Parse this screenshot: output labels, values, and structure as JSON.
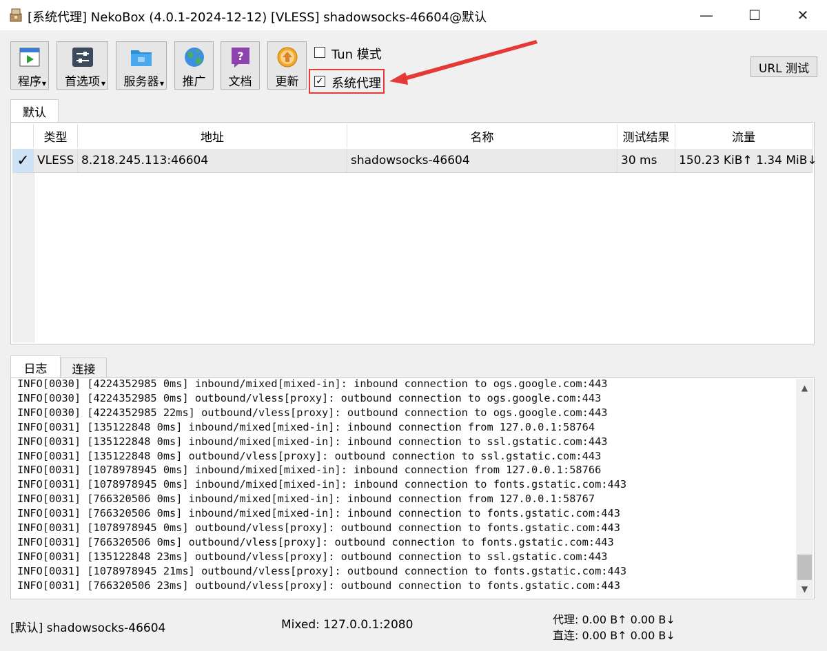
{
  "window": {
    "title": "[系统代理] NekoBox (4.0.1-2024-12-12) [VLESS] shadowsocks-46604@默认",
    "minimize_glyph": "—",
    "maximize_glyph": "☐",
    "close_glyph": "✕"
  },
  "toolbar": {
    "buttons": [
      {
        "label": "程序",
        "icon": "program-icon"
      },
      {
        "label": "首选项",
        "icon": "preferences-icon"
      },
      {
        "label": "服务器",
        "icon": "server-folder-icon"
      },
      {
        "label": "推广",
        "icon": "globe-icon"
      },
      {
        "label": "文档",
        "icon": "help-doc-icon"
      },
      {
        "label": "更新",
        "icon": "update-icon"
      }
    ],
    "tun_mode_label": "Tun 模式",
    "tun_checked": false,
    "system_proxy_label": "系统代理",
    "system_proxy_checked": true,
    "url_test_label": "URL 测试"
  },
  "group_tab": "默认",
  "table": {
    "headers": [
      "类型",
      "地址",
      "名称",
      "测试结果",
      "流量"
    ],
    "rows": [
      {
        "selected_mark": "✓",
        "type": "VLESS",
        "address": "8.218.245.113:46604",
        "name": "shadowsocks-46604",
        "test_result": "30 ms",
        "traffic": "150.23 KiB↑ 1.34 MiB↓"
      }
    ]
  },
  "log_tabs": [
    "日志",
    "连接"
  ],
  "log_lines": [
    "INFO[0030] [4224352985 0ms] inbound/mixed[mixed-in]: inbound connection to ogs.google.com:443",
    "INFO[0030] [4224352985 0ms] outbound/vless[proxy]: outbound connection to ogs.google.com:443",
    "INFO[0030] [4224352985 22ms] outbound/vless[proxy]: outbound connection to ogs.google.com:443",
    "INFO[0031] [135122848 0ms] inbound/mixed[mixed-in]: inbound connection from 127.0.0.1:58764",
    "INFO[0031] [135122848 0ms] inbound/mixed[mixed-in]: inbound connection to ssl.gstatic.com:443",
    "INFO[0031] [135122848 0ms] outbound/vless[proxy]: outbound connection to ssl.gstatic.com:443",
    "INFO[0031] [1078978945 0ms] inbound/mixed[mixed-in]: inbound connection from 127.0.0.1:58766",
    "INFO[0031] [1078978945 0ms] inbound/mixed[mixed-in]: inbound connection to fonts.gstatic.com:443",
    "INFO[0031] [766320506 0ms] inbound/mixed[mixed-in]: inbound connection from 127.0.0.1:58767",
    "INFO[0031] [766320506 0ms] inbound/mixed[mixed-in]: inbound connection to fonts.gstatic.com:443",
    "INFO[0031] [1078978945 0ms] outbound/vless[proxy]: outbound connection to fonts.gstatic.com:443",
    "INFO[0031] [766320506 0ms] outbound/vless[proxy]: outbound connection to fonts.gstatic.com:443",
    "INFO[0031] [135122848 23ms] outbound/vless[proxy]: outbound connection to ssl.gstatic.com:443",
    "INFO[0031] [1078978945 21ms] outbound/vless[proxy]: outbound connection to fonts.gstatic.com:443",
    "INFO[0031] [766320506 23ms] outbound/vless[proxy]: outbound connection to fonts.gstatic.com:443"
  ],
  "status": {
    "profile": "[默认] shadowsocks-46604",
    "mixed": "Mixed: 127.0.0.1:2080",
    "proxy_traffic": "代理: 0.00 B↑ 0.00 B↓",
    "direct_traffic": "直连: 0.00 B↑ 0.00 B↓"
  },
  "colors": {
    "highlight": "#e53935",
    "selected_cell": "#cfe3f7",
    "selected_row": "#eaeaea"
  }
}
